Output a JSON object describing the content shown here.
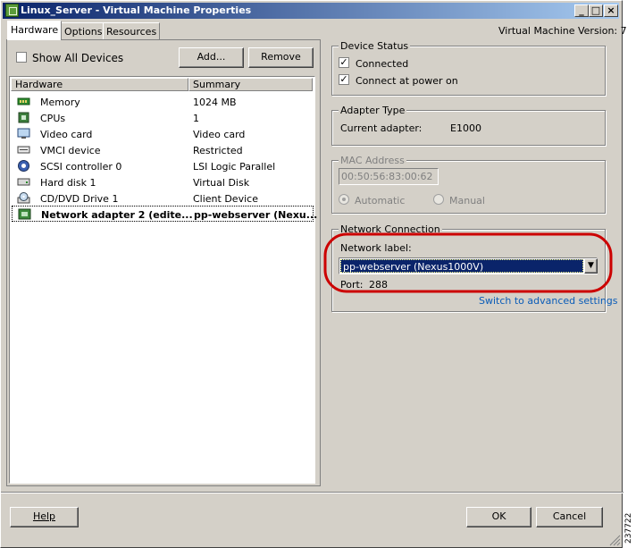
{
  "window": {
    "title": "Linux_Server - Virtual Machine Properties",
    "controls": {
      "minimize": "_",
      "maximize": "□",
      "close": "×"
    }
  },
  "tabs": [
    {
      "label": "Hardware",
      "active": true
    },
    {
      "label": "Options",
      "active": false
    },
    {
      "label": "Resources",
      "active": false
    }
  ],
  "vm_version": "Virtual Machine Version: 7",
  "left": {
    "show_all_devices": {
      "label": "Show All Devices",
      "checked": false
    },
    "add_label": "Add...",
    "remove_label": "Remove",
    "columns": [
      "Hardware",
      "Summary"
    ],
    "rows": [
      {
        "icon": "memory-icon",
        "hardware": "Memory",
        "summary": "1024 MB"
      },
      {
        "icon": "cpu-icon",
        "hardware": "CPUs",
        "summary": "1"
      },
      {
        "icon": "video-card-icon",
        "hardware": "Video card",
        "summary": "Video card"
      },
      {
        "icon": "vmci-device-icon",
        "hardware": "VMCI device",
        "summary": "Restricted"
      },
      {
        "icon": "scsi-controller-icon",
        "hardware": "SCSI controller 0",
        "summary": "LSI Logic Parallel"
      },
      {
        "icon": "hard-disk-icon",
        "hardware": "Hard disk 1",
        "summary": "Virtual Disk"
      },
      {
        "icon": "cd-dvd-icon",
        "hardware": "CD/DVD Drive 1",
        "summary": "Client Device"
      },
      {
        "icon": "network-adapter-icon",
        "hardware": "Network adapter 2 (edite...",
        "summary": "pp-webserver (Nexu...",
        "selected": true
      }
    ]
  },
  "device_status": {
    "label": "Device Status",
    "connected": {
      "label": "Connected",
      "checked": true
    },
    "connect_at_power_on": {
      "label": "Connect at power on",
      "checked": true
    }
  },
  "adapter_type": {
    "label": "Adapter Type",
    "current_label": "Current adapter:",
    "current_value": "E1000"
  },
  "mac_address": {
    "label": "MAC Address",
    "value": "00:50:56:83:00:62",
    "automatic": "Automatic",
    "manual": "Manual"
  },
  "network_connection": {
    "label": "Network Connection",
    "network_label": "Network label:",
    "selected": "pp-webserver (Nexus1000V)",
    "port_label": "Port:",
    "port_value": "288",
    "advanced_link": "Switch to advanced settings",
    "highlight_color": "#cc0000"
  },
  "footer": {
    "help": "Help",
    "ok": "OK",
    "cancel": "Cancel",
    "figure_number": "237722"
  },
  "colors": {
    "title_gradient_start": "#0a246a",
    "title_gradient_end": "#a6caf0",
    "selection": "#0a246a",
    "link": "#0a5cb8"
  }
}
